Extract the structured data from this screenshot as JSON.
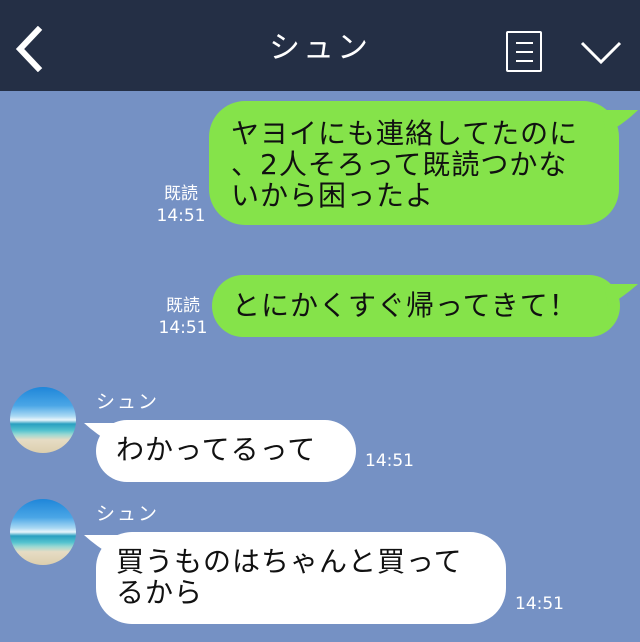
{
  "header": {
    "title": "シュン",
    "back_icon": "chevron-left-icon",
    "menu_icon": "notes-icon",
    "dropdown_icon": "chevron-down-icon",
    "background": "#242f45"
  },
  "chat": {
    "background": "#7591c4",
    "outgoing_color": "#85e34a",
    "incoming_color": "#ffffff"
  },
  "messages": [
    {
      "direction": "out",
      "text": "ヤヨイにも連絡してたのに、2人そろって既読つかないから困ったよ",
      "lines": [
        "ヤヨイにも連絡してたのに",
        "、2人そろって既読つかな",
        "いから困ったよ"
      ],
      "read": "既読",
      "time": "14:51"
    },
    {
      "direction": "out",
      "text": "とにかくすぐ帰ってきて！",
      "lines": [
        "とにかくすぐ帰ってきて！"
      ],
      "read": "既読",
      "time": "14:51"
    },
    {
      "direction": "in",
      "sender": "シュン",
      "text": "わかってるって",
      "lines": [
        "わかってるって"
      ],
      "time": "14:51"
    },
    {
      "direction": "in",
      "sender": "シュン",
      "text": "買うものはちゃんと買ってるから",
      "lines": [
        "買うものはちゃんと買って",
        "るから"
      ],
      "time": "14:51"
    }
  ]
}
